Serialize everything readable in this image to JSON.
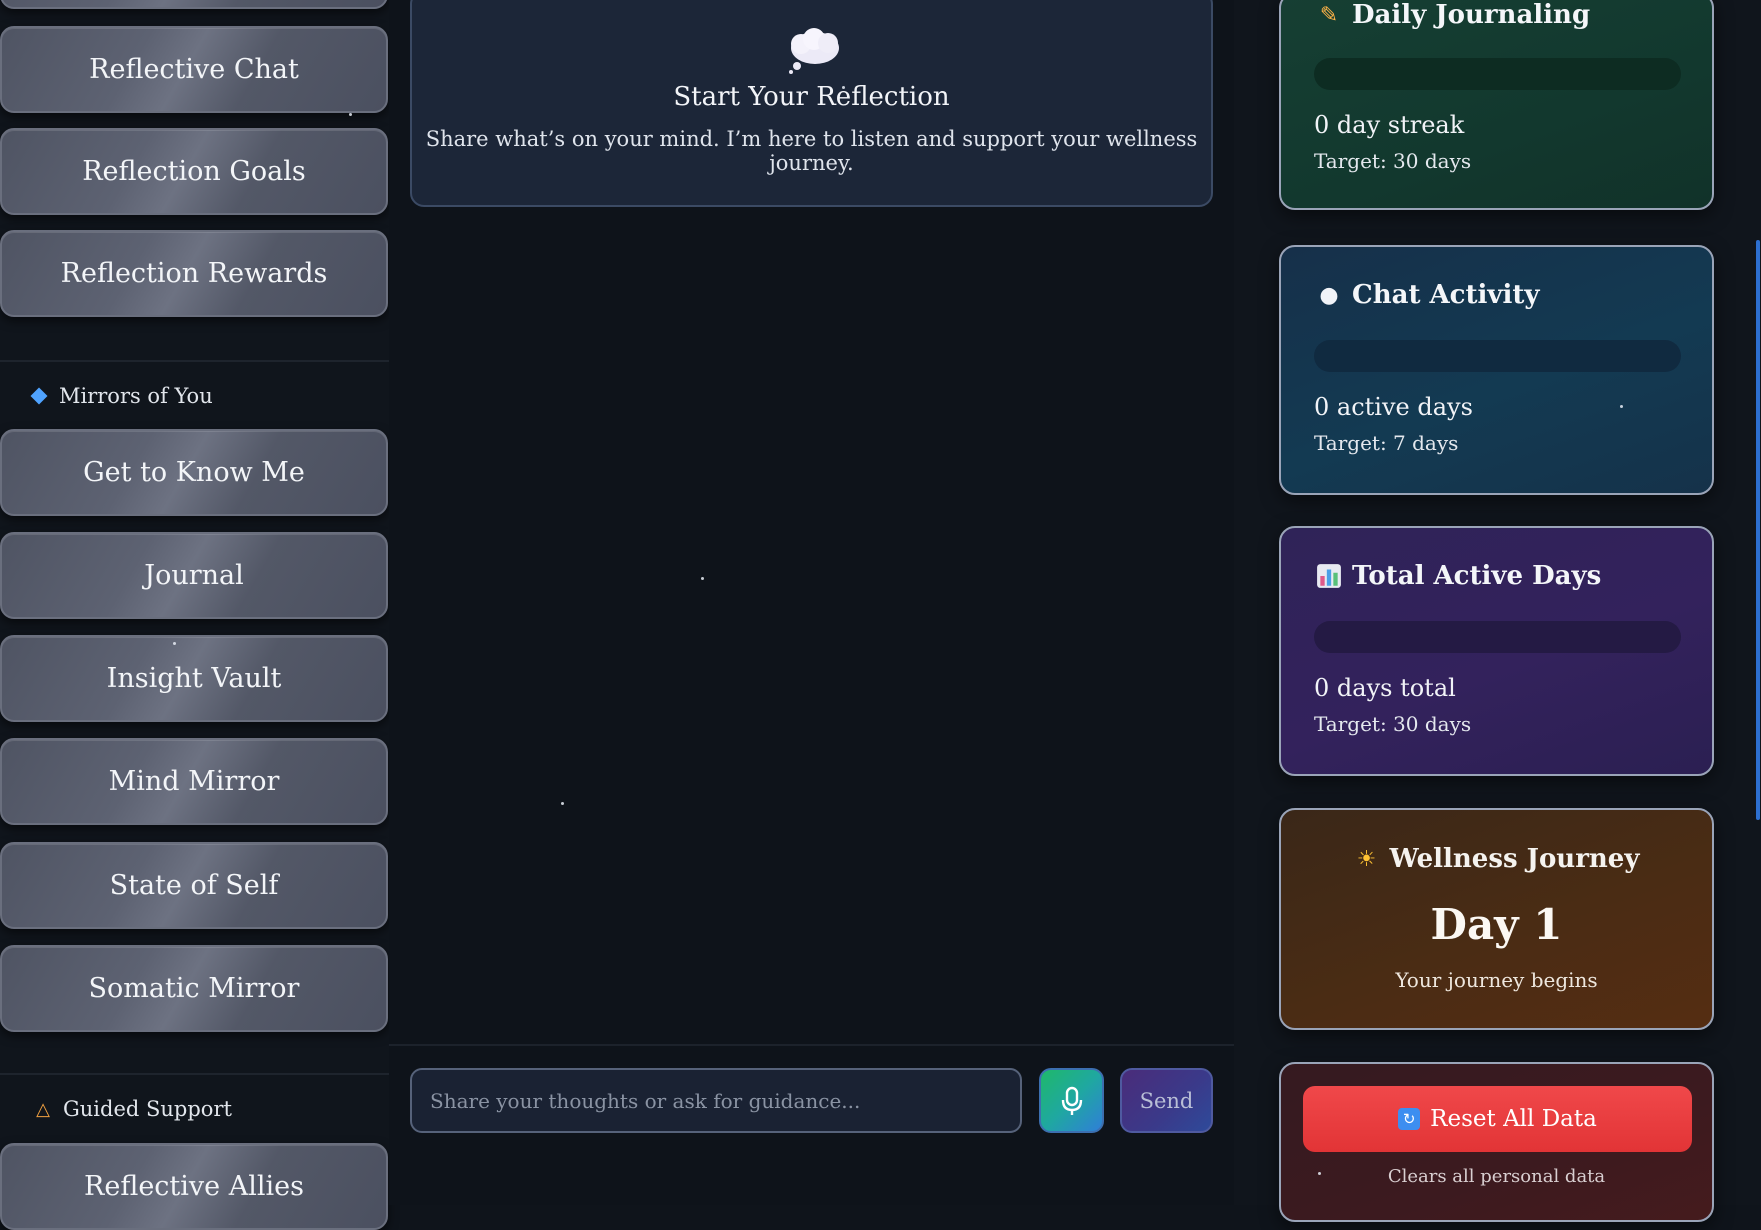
{
  "sidebar": {
    "top_items": [
      {
        "label": "Reflective Chat"
      },
      {
        "label": "Reflection Goals"
      },
      {
        "label": "Reflection Rewards"
      }
    ],
    "sections": [
      {
        "label": "Mirrors of You",
        "icon": "diamond-icon",
        "items": [
          {
            "label": "Get to Know Me"
          },
          {
            "label": "Journal"
          },
          {
            "label": "Insight Vault"
          },
          {
            "label": "Mind Mirror"
          },
          {
            "label": "State of Self"
          },
          {
            "label": "Somatic Mirror"
          }
        ]
      },
      {
        "label": "Guided Support",
        "icon": "meditation-icon",
        "items": [
          {
            "label": "Reflective Allies"
          }
        ]
      }
    ]
  },
  "main": {
    "welcome": {
      "icon": "thought-bubble-icon",
      "title": "Start Your Reflection",
      "text": "Share what’s on your mind. I’m here to listen and support your wellness journey."
    },
    "composer": {
      "placeholder": "Share your thoughts or ask for guidance...",
      "value": "",
      "mic_icon": "microphone-icon",
      "send_label": "Send"
    }
  },
  "stats": {
    "daily_journaling": {
      "icon": "memo-icon",
      "title": "Daily Journaling",
      "progress": 0,
      "value": "0 day streak",
      "target": "Target: 30 days"
    },
    "chat_activity": {
      "icon": "speech-bubble-icon",
      "title": "Chat Activity",
      "progress": 0,
      "value": "0 active days",
      "target": "Target: 7 days"
    },
    "total_active_days": {
      "icon": "bar-chart-icon",
      "title": "Total Active Days",
      "progress": 0,
      "value": "0 days total",
      "target": "Target: 30 days"
    },
    "wellness": {
      "icon": "sun-icon",
      "title": "Wellness Journey",
      "day": "Day 1",
      "subtitle": "Your journey begins"
    },
    "reset": {
      "icon": "refresh-icon",
      "label": "Reset All Data",
      "note": "Clears all personal data"
    }
  },
  "colors": {
    "accent_blue": "#4fa3ff",
    "reset_red": "#e23436",
    "journal_card": "#12382e",
    "chat_card": "#133a52",
    "total_card": "#33225c",
    "wellness_card": "#4a2c14"
  }
}
